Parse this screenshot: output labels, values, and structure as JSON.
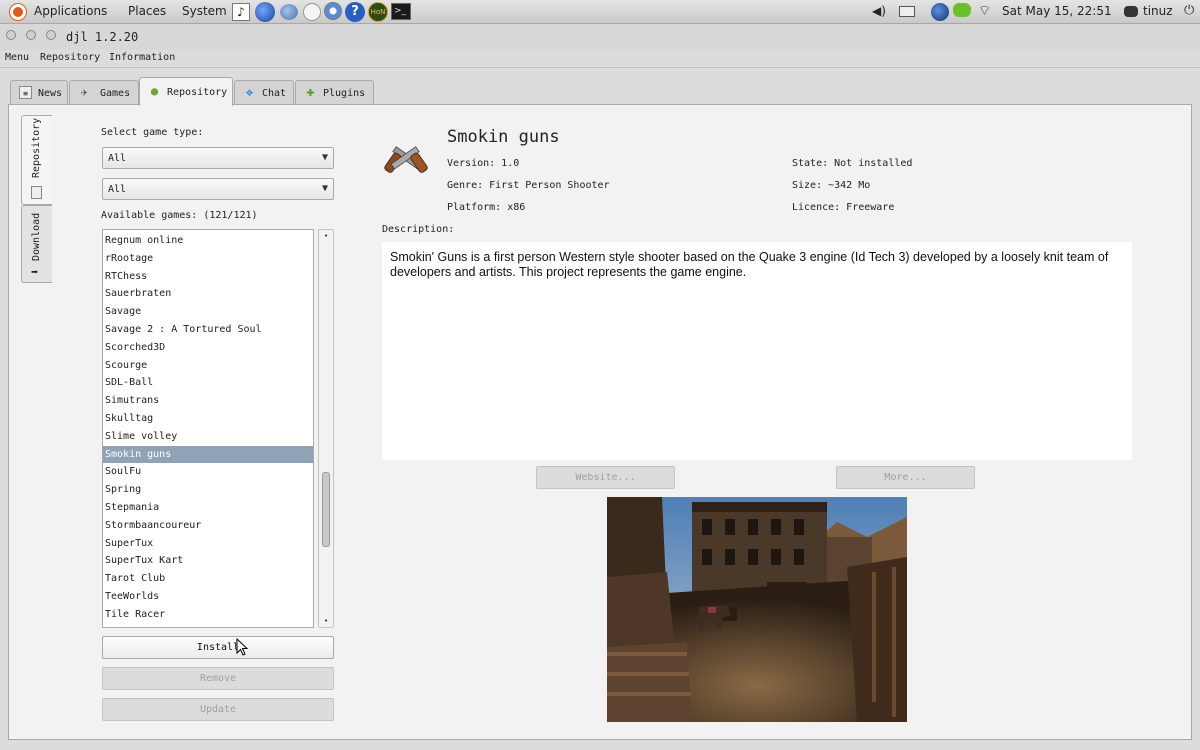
{
  "panel": {
    "menus": [
      "Applications",
      "Places",
      "System"
    ],
    "clock": "Sat May 15, 22:51",
    "user": "tinuz",
    "colors": {
      "accent": "#e05a1c"
    }
  },
  "window": {
    "title": "djl 1.2.20",
    "menu": [
      "Menu",
      "Repository",
      "Information"
    ]
  },
  "tabs": [
    {
      "label": "News",
      "icon": "newspaper-icon"
    },
    {
      "label": "Games",
      "icon": "plane-icon"
    },
    {
      "label": "Repository",
      "icon": "bulb-icon",
      "active": true
    },
    {
      "label": "Chat",
      "icon": "chat-icon"
    },
    {
      "label": "Plugins",
      "icon": "plus-icon"
    }
  ],
  "side_tabs": [
    {
      "label": "Repository",
      "active": true
    },
    {
      "label": "Download"
    }
  ],
  "repository": {
    "select_label": "Select game type:",
    "filter1": "All",
    "filter2": "All",
    "available_label": "Available games: (121/121)",
    "games": [
      "Regnum online",
      "rRootage",
      "RTChess",
      "Sauerbraten",
      "Savage",
      "Savage 2 : A Tortured Soul",
      "Scorched3D",
      "Scourge",
      "SDL-Ball",
      "Simutrans",
      "Skulltag",
      "Slime volley",
      "Smokin guns",
      "SoulFu",
      "Spring",
      "Stepmania",
      "Stormbaancoureur",
      "SuperTux",
      "SuperTux Kart",
      "Tarot Club",
      "TeeWorlds",
      "Tile Racer"
    ],
    "selected_index": 12,
    "install_label": "Install",
    "remove_label": "Remove",
    "update_label": "Update"
  },
  "details": {
    "title": "Smokin guns",
    "version": "Version: 1.0",
    "genre": "Genre: First Person Shooter",
    "platform": "Platform: x86",
    "state": "State: Not installed",
    "size": "Size: ~342 Mo",
    "licence": "Licence: Freeware",
    "description_label": "Description:",
    "description": "Smokin' Guns is a first person Western style shooter based on the Quake 3 engine (Id Tech 3) developed by a loosely knit team of developers and artists. This project represents the game engine.",
    "website_label": "Website...",
    "more_label": "More..."
  }
}
